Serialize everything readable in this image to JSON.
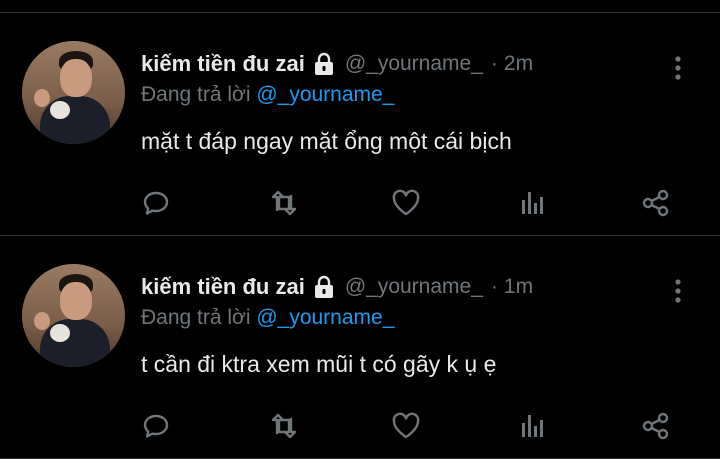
{
  "tweets": [
    {
      "display_name": "kiếm tiền đu zai",
      "handle": "@_yourname_",
      "separator": "·",
      "time": "2m",
      "reply_prefix": "Đang trả lời",
      "reply_to": "@_yourname_",
      "text": "mặt t đáp ngay mặt ổng một cái bịch"
    },
    {
      "display_name": "kiếm tiền đu zai",
      "handle": "@_yourname_",
      "separator": "·",
      "time": "1m",
      "reply_prefix": "Đang trả lời",
      "reply_to": "@_yourname_",
      "text": "t cần đi ktra xem mũi t có gãy k ụ ẹ"
    }
  ],
  "icons": {
    "lock": "lock-icon",
    "more": "more-vertical-icon",
    "reply": "reply-icon",
    "retweet": "retweet-icon",
    "like": "heart-icon",
    "stats": "stats-icon",
    "share": "share-icon"
  },
  "colors": {
    "background": "#000000",
    "text": "#e7e9ea",
    "muted": "#71767b",
    "link": "#1d9bf0",
    "divider": "#2f3336"
  }
}
